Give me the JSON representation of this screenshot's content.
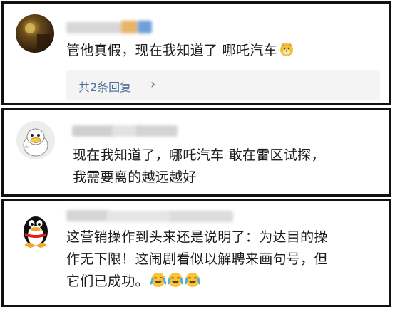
{
  "comments": [
    {
      "text": "管他真假，现在我知道了 哪吒汽车",
      "emoji": "doge-emoji",
      "reply_label": "共2条回复",
      "reply_chevron": "›",
      "avatar": "dark-photo-avatar"
    },
    {
      "lines": [
        "现在我知道了，哪吒汽车  敢在雷区试探，",
        "我需要离的越远越好"
      ],
      "avatar": "cartoon-duck-avatar"
    },
    {
      "lines": [
        "这营销操作到头来还是说明了：为达目的操",
        "作无下限！这闹剧看似以解聘来画句号，但",
        "它们已成功。"
      ],
      "emoji": "crying-laughing-emoji",
      "avatar": "qq-penguin-avatar"
    }
  ],
  "colors": {
    "link": "#4a6e9a",
    "border": "#111111",
    "reply_bg": "#f4f4f4"
  }
}
